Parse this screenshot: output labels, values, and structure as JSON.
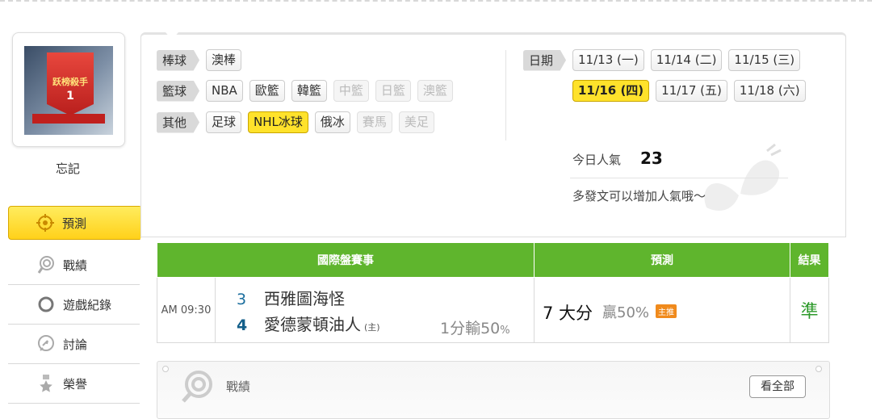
{
  "user": {
    "name": "忘記",
    "avatar_banner_text": "跃榜殺手",
    "avatar_rank": "1"
  },
  "sidebar": {
    "items": [
      {
        "label": "預測",
        "icon": "target-icon",
        "active": true
      },
      {
        "label": "戰績",
        "icon": "record-icon"
      },
      {
        "label": "遊戲紀錄",
        "icon": "circle-icon"
      },
      {
        "label": "討論",
        "icon": "chat-icon"
      },
      {
        "label": "榮譽",
        "icon": "star-medal-icon"
      }
    ]
  },
  "filters": {
    "baseball": {
      "label": "棒球",
      "options": [
        "澳棒"
      ]
    },
    "basketball": {
      "label": "籃球",
      "options": [
        "NBA",
        "歐籃",
        "韓籃",
        "中籃",
        "日籃",
        "澳籃"
      ]
    },
    "other": {
      "label": "其他",
      "options": [
        "足球",
        "NHL冰球",
        "俄冰",
        "賽馬",
        "美足"
      ]
    },
    "date": {
      "label": "日期",
      "options": [
        "11/13 (一)",
        "11/14 (二)",
        "11/15 (三)",
        "11/16 (四)",
        "11/17 (五)",
        "11/18 (六)"
      ]
    }
  },
  "popularity": {
    "label": "今日人氣",
    "value": "23",
    "note": "多發文可以增加人氣哦〜"
  },
  "table": {
    "headers": [
      "國際盤賽事",
      "預測",
      "結果"
    ],
    "row": {
      "time": "AM 09:30",
      "away_no": "3",
      "away_team": "西雅圖海怪",
      "home_no": "4",
      "home_team": "愛德蒙頓油人",
      "home_mark": "(主)",
      "odds_main": "1分輸",
      "odds_pct": "50",
      "odds_pct_unit": "%",
      "prediction": "7 大分",
      "win_rate": "贏50%",
      "badge": "主推",
      "result": "準"
    }
  },
  "record": {
    "title": "戰績",
    "view_all": "看全部"
  },
  "colors": {
    "accent_yellow": "#ffe22b",
    "header_green": "#5fb52d",
    "result_green": "#2e9a2b"
  }
}
